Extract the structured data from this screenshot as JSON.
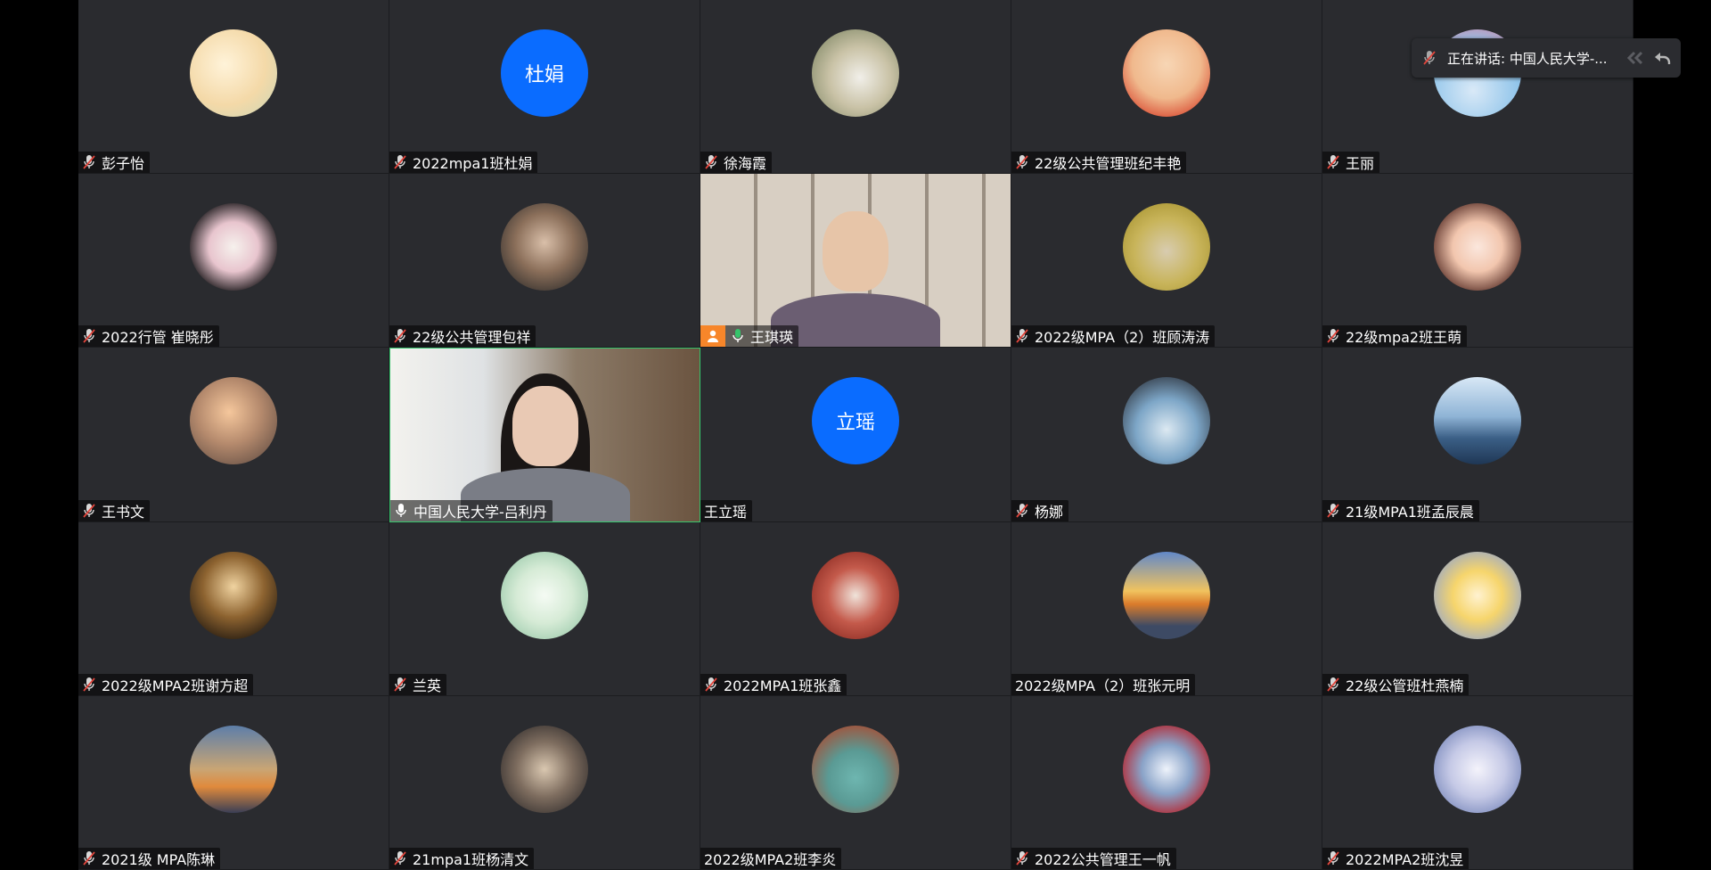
{
  "speaking": {
    "label": "正在讲话: 中国人民大学-...",
    "collapse_icon": "chevrons-left-icon",
    "back_icon": "reply-arrow-icon"
  },
  "participants": [
    {
      "name": "彭子怡",
      "mic": "muted",
      "avatar": {
        "kind": "image",
        "desc": "cartoon-girl-cat"
      }
    },
    {
      "name": "2022mpa1班杜娟",
      "mic": "muted",
      "avatar": {
        "kind": "text",
        "text": "杜娟",
        "color": "#0a6cff"
      }
    },
    {
      "name": "徐海霞",
      "mic": "muted",
      "avatar": {
        "kind": "image",
        "desc": "woman-outdoor"
      }
    },
    {
      "name": "22级公共管理班纪丰艳",
      "mic": "muted",
      "avatar": {
        "kind": "image",
        "desc": "crayon-shinchan"
      }
    },
    {
      "name": "王丽",
      "mic": "muted",
      "avatar": {
        "kind": "image",
        "desc": "cartoon-blue"
      }
    },
    {
      "name": "2022行管 崔晓彤",
      "mic": "muted",
      "avatar": {
        "kind": "image",
        "desc": "flowers-cat"
      }
    },
    {
      "name": "22级公共管理包祥",
      "mic": "muted",
      "avatar": {
        "kind": "image",
        "desc": "man-portrait"
      }
    },
    {
      "name": "王琪瑛",
      "mic": "active",
      "host": true,
      "avatar": {
        "kind": "video",
        "desc": "man-bookshelf"
      }
    },
    {
      "name": "2022级MPA（2）班顾涛涛",
      "mic": "muted",
      "avatar": {
        "kind": "image",
        "desc": "cartoon-cat-hat"
      }
    },
    {
      "name": "22级mpa2班王萌",
      "mic": "muted",
      "avatar": {
        "kind": "image",
        "desc": "illustrated-girl"
      }
    },
    {
      "name": "王书文",
      "mic": "muted",
      "avatar": {
        "kind": "image",
        "desc": "person-orange"
      }
    },
    {
      "name": "中国人民大学-吕利丹",
      "mic": "speaking",
      "speaking": true,
      "avatar": {
        "kind": "video",
        "desc": "woman-room"
      }
    },
    {
      "name": "王立瑶",
      "mic": "none",
      "avatar": {
        "kind": "text",
        "text": "立瑶",
        "color": "#0a6cff"
      }
    },
    {
      "name": "杨娜",
      "mic": "muted",
      "avatar": {
        "kind": "image",
        "desc": "football-player"
      }
    },
    {
      "name": "21级MPA1班孟辰晨",
      "mic": "muted",
      "avatar": {
        "kind": "image",
        "desc": "sea-sky"
      }
    },
    {
      "name": "2022级MPA2班谢方超",
      "mic": "muted",
      "avatar": {
        "kind": "image",
        "desc": "clock-silhouette"
      }
    },
    {
      "name": "兰英",
      "mic": "muted",
      "avatar": {
        "kind": "image",
        "desc": "ink-landscape"
      }
    },
    {
      "name": "2022MPA1班张鑫",
      "mic": "muted",
      "avatar": {
        "kind": "image",
        "desc": "red-fist"
      }
    },
    {
      "name": "2022级MPA（2）班张元明",
      "mic": "none",
      "avatar": {
        "kind": "image",
        "desc": "mountain-sunrise"
      }
    },
    {
      "name": "22级公管班杜燕楠",
      "mic": "muted",
      "avatar": {
        "kind": "image",
        "desc": "sailor-moon"
      }
    },
    {
      "name": "2021级 MPA陈琳",
      "mic": "muted",
      "avatar": {
        "kind": "image",
        "desc": "sunset-clouds"
      }
    },
    {
      "name": "21mpa1班杨清文",
      "mic": "muted",
      "avatar": {
        "kind": "image",
        "desc": "movie-still"
      }
    },
    {
      "name": "2022级MPA2班李炎",
      "mic": "none",
      "avatar": {
        "kind": "image",
        "desc": "bear-hoodie"
      }
    },
    {
      "name": "2022公共管理王一帆",
      "mic": "muted",
      "avatar": {
        "kind": "image",
        "desc": "gamer-headset"
      }
    },
    {
      "name": "2022MPA2班沈昱",
      "mic": "muted",
      "avatar": {
        "kind": "image",
        "desc": "anime-white-hair"
      }
    }
  ]
}
